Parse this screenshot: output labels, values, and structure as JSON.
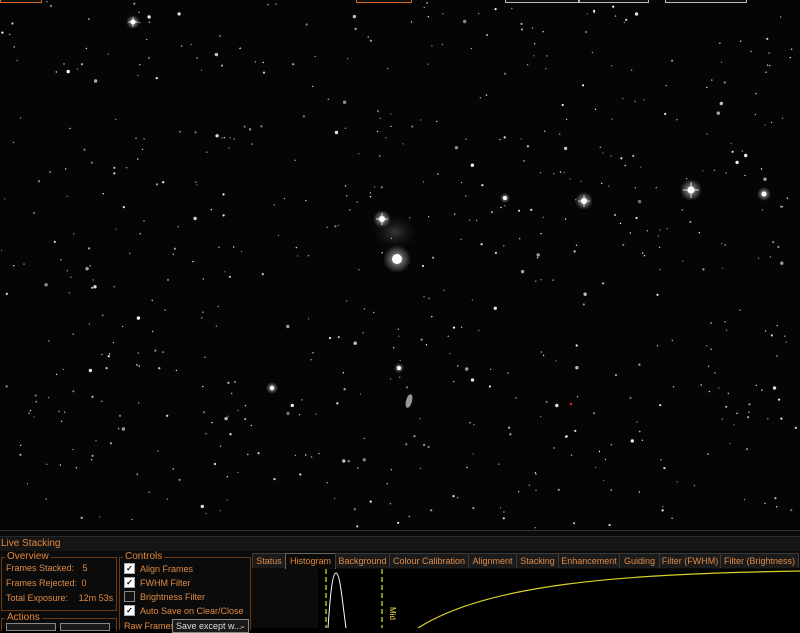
{
  "panel": {
    "title": "Live Stacking",
    "overview": {
      "title": "Overview",
      "frames_stacked_label": "Frames Stacked:",
      "frames_stacked_value": "5",
      "frames_rejected_label": "Frames Rejected:",
      "frames_rejected_value": "0",
      "total_exposure_label": "Total Exposure:",
      "total_exposure_value": "12m 53s"
    },
    "controls": {
      "title": "Controls",
      "items": [
        {
          "label": "Align Frames",
          "checked": true
        },
        {
          "label": "FWHM Filter",
          "checked": true
        },
        {
          "label": "Brightness Filter",
          "checked": false
        },
        {
          "label": "Auto Save on Clear/Close",
          "checked": true
        }
      ],
      "raw_frames_label": "Raw Frames",
      "raw_frames_value": "Save except w..."
    },
    "actions": {
      "title": "Actions"
    },
    "tabs": [
      {
        "label": "Status",
        "active": false
      },
      {
        "label": "Histogram",
        "active": true
      },
      {
        "label": "Background",
        "active": false
      },
      {
        "label": "Colour Calibration",
        "active": false
      },
      {
        "label": "Alignment",
        "active": false
      },
      {
        "label": "Stacking",
        "active": false
      },
      {
        "label": "Enhancement",
        "active": false
      },
      {
        "label": "Guiding",
        "active": false
      },
      {
        "label": "Filter (FWHM)",
        "active": false
      },
      {
        "label": "Filter (Brightness)",
        "active": false
      }
    ],
    "histogram": {
      "mid_label": "Mid"
    }
  },
  "colors": {
    "accent": "#e4873a",
    "curve": "#d9d02a",
    "marker": "#f0e04a"
  }
}
